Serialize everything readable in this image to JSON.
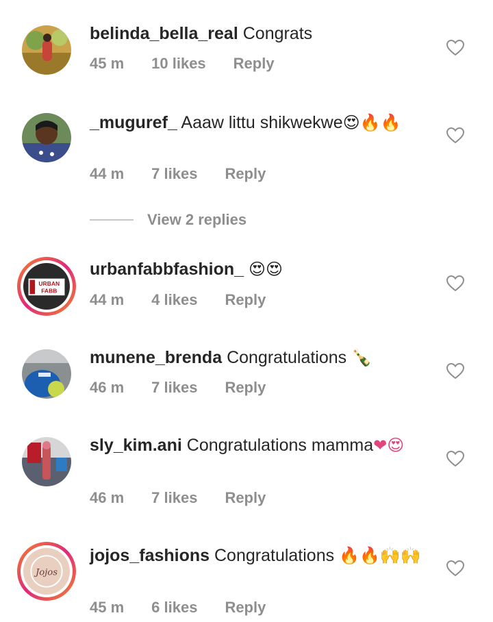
{
  "comments": [
    {
      "username": "belinda_bella_real",
      "text": "Congrats",
      "time": "45 m",
      "likes": "10 likes",
      "reply": "Reply",
      "emoji": ""
    },
    {
      "username": "_muguref_",
      "text": "Aaaw littu shikwekwe",
      "time": "44 m",
      "likes": "7 likes",
      "reply": "Reply",
      "emoji": "😍🔥🔥"
    },
    {
      "username": "urbanfabbfashion_",
      "text": "",
      "time": "44 m",
      "likes": "4 likes",
      "reply": "Reply",
      "emoji": "😍😍"
    },
    {
      "username": "munene_brenda",
      "text": "Congratulations",
      "time": "46 m",
      "likes": "7 likes",
      "reply": "Reply",
      "emoji": "🍾"
    },
    {
      "username": "sly_kim.ani",
      "text": "Congratulations mamma",
      "time": "46 m",
      "likes": "7 likes",
      "reply": "Reply",
      "emoji": "❤😍"
    },
    {
      "username": "jojos_fashions",
      "text": "Congratulations",
      "time": "45 m",
      "likes": "6 likes",
      "reply": "Reply",
      "emoji": "🔥🔥🙌🙌"
    }
  ],
  "view_replies": "View 2 replies",
  "logo_urban": "URBAN FABB",
  "logo_jojos": "Jojos",
  "colors": {
    "text": "#262626",
    "meta": "#8e8e8e",
    "ring": "#dd2a7b"
  }
}
